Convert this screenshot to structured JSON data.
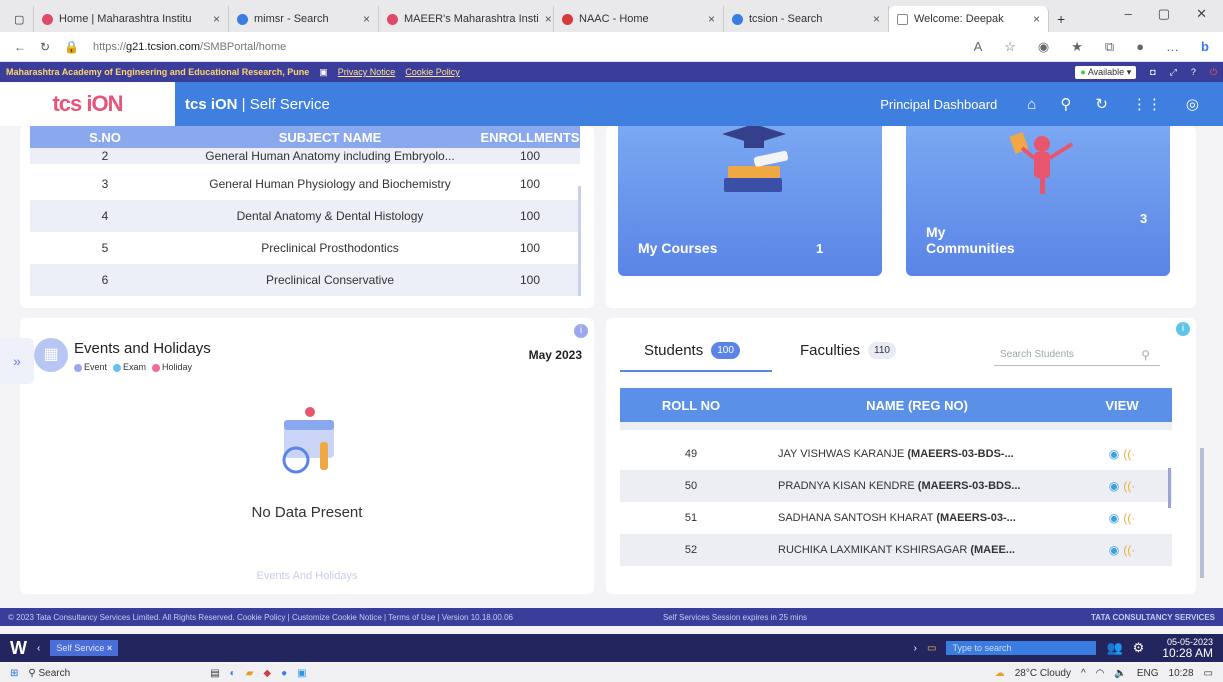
{
  "browser": {
    "tabs": [
      {
        "title": "Home | Maharashtra Institu",
        "favicon": "#e04a6a"
      },
      {
        "title": "mimsr - Search",
        "favicon": "#3a7ce0"
      },
      {
        "title": "MAEER's Maharashtra Insti",
        "favicon": "#e04a6a"
      },
      {
        "title": "NAAC - Home",
        "favicon": "#d83a3a"
      },
      {
        "title": "tcsion - Search",
        "favicon": "#3a7ce0"
      },
      {
        "title": "Welcome: Deepak",
        "favicon": "#ffffff"
      }
    ],
    "url_prefix": "https://",
    "url_host": "g21.tcsion.com",
    "url_path": "/SMBPortal/home"
  },
  "org_bar": {
    "name": "Maharashtra Academy of Engineering and Educational Research, Pune",
    "privacy": "Privacy Notice",
    "cookie": "Cookie Policy",
    "status": "Available"
  },
  "header": {
    "logo": "tcs iON",
    "brand": "tcs iON",
    "section": "Self Service",
    "dashboard": "Principal Dashboard"
  },
  "subjects": {
    "columns": [
      "S.NO",
      "SUBJECT NAME",
      "ENROLLMENTS"
    ],
    "rows": [
      {
        "sno": "2",
        "name": "General Human Anatomy including Embryolo...",
        "enroll": "100"
      },
      {
        "sno": "3",
        "name": "General Human Physiology and Biochemistry",
        "enroll": "100"
      },
      {
        "sno": "4",
        "name": "Dental Anatomy & Dental Histology",
        "enroll": "100"
      },
      {
        "sno": "5",
        "name": "Preclinical Prosthodontics",
        "enroll": "100"
      },
      {
        "sno": "6",
        "name": "Preclinical Conservative",
        "enroll": "100"
      }
    ]
  },
  "tiles": [
    {
      "label": "My Courses",
      "count": "1"
    },
    {
      "label": "My Communities",
      "count": "3"
    }
  ],
  "events": {
    "title": "Events and Holidays",
    "legend": [
      {
        "label": "Event",
        "color": "#9ba8f0"
      },
      {
        "label": "Exam",
        "color": "#5fc4ea"
      },
      {
        "label": "Holiday",
        "color": "#f06a9a"
      }
    ],
    "month": "May 2023",
    "empty": "No Data Present",
    "footer": "Events And Holidays"
  },
  "students": {
    "tab_students": "Students",
    "students_count": "100",
    "tab_faculties": "Faculties",
    "faculties_count": "110",
    "search_placeholder": "Search Students",
    "columns": [
      "ROLL NO",
      "NAME (REG NO)",
      "VIEW"
    ],
    "rows": [
      {
        "roll": "49",
        "name": "JAY VISHWAS KARANJE",
        "reg": "(MAEERS-03-BDS-..."
      },
      {
        "roll": "50",
        "name": "PRADNYA KISAN KENDRE",
        "reg": "(MAEERS-03-BDS..."
      },
      {
        "roll": "51",
        "name": "SADHANA SANTOSH KHARAT",
        "reg": "(MAEERS-03-..."
      },
      {
        "roll": "52",
        "name": "RUCHIKA LAXMIKANT KSHIRSAGAR",
        "reg": "(MAEE..."
      }
    ]
  },
  "footer": {
    "left": "© 2023 Tata Consultancy Services Limited. All Rights Reserved.  Cookie Policy | Customize Cookie Notice | Terms of Use | Version 10.18.00.06",
    "middle": "Self Services Session expires in 25 mins",
    "right": "TATA CONSULTANCY SERVICES"
  },
  "app_bar": {
    "self_service": "Self Service",
    "type_to_search": "Type to search",
    "date": "05-05-2023",
    "time": "10:28 AM"
  },
  "taskbar": {
    "search": "Search",
    "weather": "28°C Cloudy",
    "lang": "ENG",
    "time": "10:28"
  }
}
